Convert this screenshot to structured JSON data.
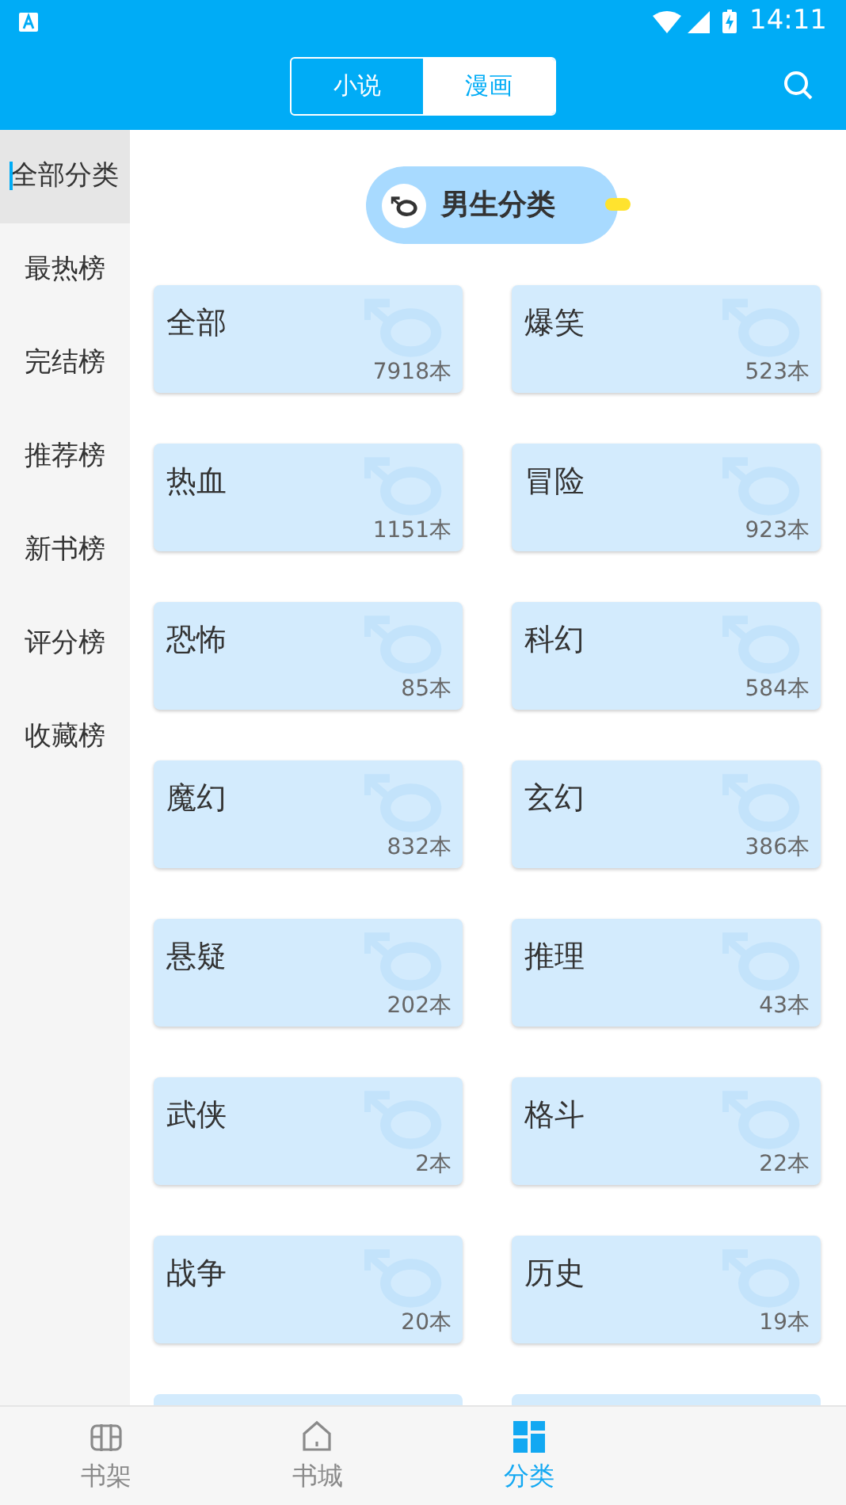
{
  "status_bar": {
    "time": "14:11"
  },
  "header": {
    "tabs": [
      {
        "label": "小说",
        "selected": false
      },
      {
        "label": "漫画",
        "selected": true
      }
    ]
  },
  "sidebar": {
    "items": [
      {
        "label": "全部分类",
        "selected": true
      },
      {
        "label": "最热榜",
        "selected": false
      },
      {
        "label": "完结榜",
        "selected": false
      },
      {
        "label": "推荐榜",
        "selected": false
      },
      {
        "label": "新书榜",
        "selected": false
      },
      {
        "label": "评分榜",
        "selected": false
      },
      {
        "label": "收藏榜",
        "selected": false
      }
    ]
  },
  "section": {
    "title": "男生分类"
  },
  "categories": [
    {
      "name": "全部",
      "count": "7918本"
    },
    {
      "name": "爆笑",
      "count": "523本"
    },
    {
      "name": "热血",
      "count": "1151本"
    },
    {
      "name": "冒险",
      "count": "923本"
    },
    {
      "name": "恐怖",
      "count": "85本"
    },
    {
      "name": "科幻",
      "count": "584本"
    },
    {
      "name": "魔幻",
      "count": "832本"
    },
    {
      "name": "玄幻",
      "count": "386本"
    },
    {
      "name": "悬疑",
      "count": "202本"
    },
    {
      "name": "推理",
      "count": "43本"
    },
    {
      "name": "武侠",
      "count": "2本"
    },
    {
      "name": "格斗",
      "count": "22本"
    },
    {
      "name": "战争",
      "count": "20本"
    },
    {
      "name": "历史",
      "count": "19本"
    }
  ],
  "bottom_nav": [
    {
      "label": "书架",
      "kind": "shelf",
      "selected": false
    },
    {
      "label": "书城",
      "kind": "home",
      "selected": false
    },
    {
      "label": "分类",
      "kind": "grid",
      "selected": true
    }
  ]
}
